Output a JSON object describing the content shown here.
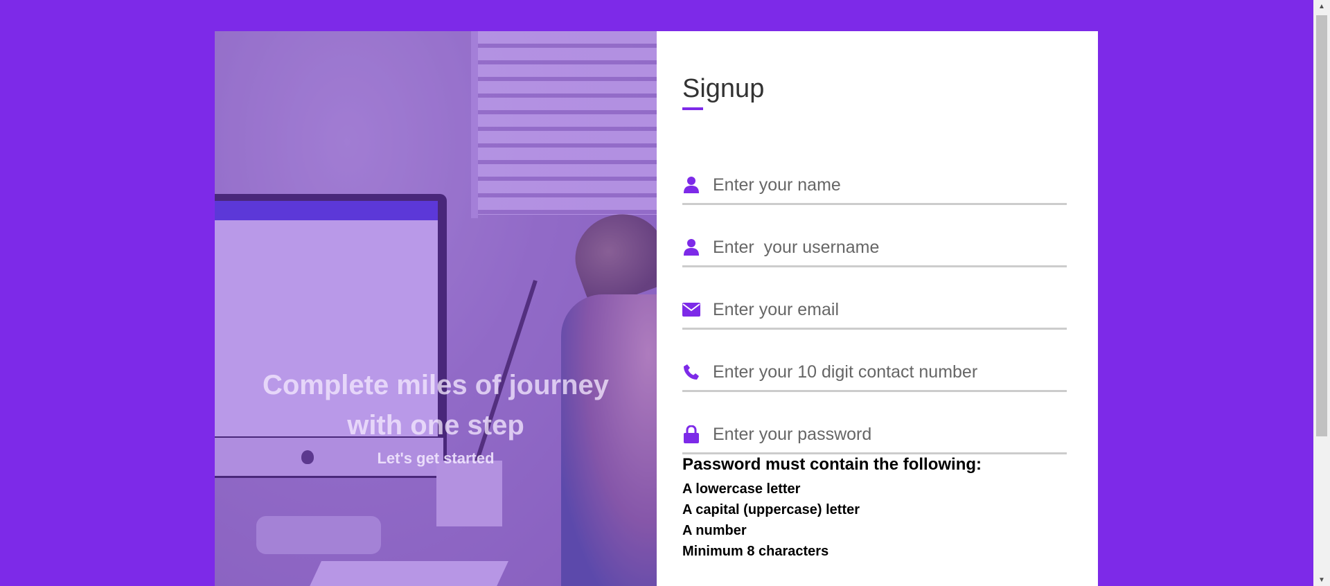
{
  "colors": {
    "accent": "#7d2ae8",
    "background": "#7d2ae8",
    "card": "#ffffff",
    "field_border": "#cccccc",
    "placeholder": "#666666"
  },
  "cover": {
    "title_line1": "Complete miles of journey",
    "title_line2": "with one step",
    "subtitle": "Let's get started"
  },
  "form": {
    "title": "Signup",
    "fields": [
      {
        "icon": "user-icon",
        "placeholder": "Enter your name"
      },
      {
        "icon": "user-icon",
        "placeholder": "Enter  your username"
      },
      {
        "icon": "envelope-icon",
        "placeholder": "Enter your email"
      },
      {
        "icon": "phone-icon",
        "placeholder": "Enter your 10 digit contact number"
      },
      {
        "icon": "lock-icon",
        "placeholder": "Enter your password"
      }
    ],
    "password_rules": {
      "heading": "Password must contain the following:",
      "items": [
        "A lowercase letter",
        "A capital (uppercase) letter",
        "A number",
        "Minimum 8 characters"
      ]
    }
  },
  "scrollbar": {
    "up_arrow": "▲",
    "down_arrow": "▼"
  }
}
